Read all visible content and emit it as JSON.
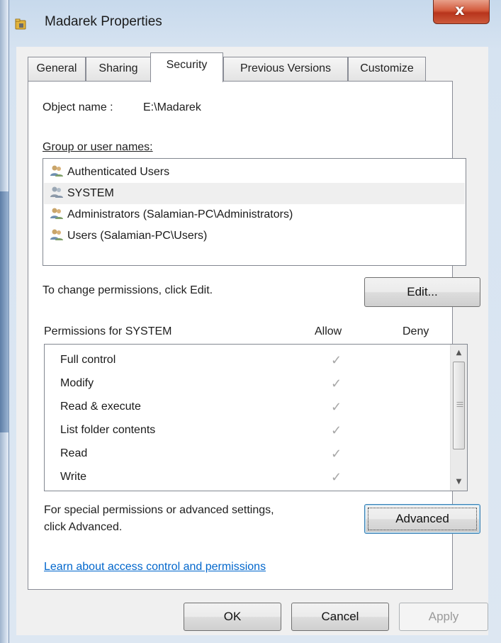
{
  "window": {
    "title": "Madarek Properties",
    "close_glyph": "x",
    "app_icon": "folder-lock-icon"
  },
  "tabs": [
    {
      "label": "General"
    },
    {
      "label": "Sharing"
    },
    {
      "label": "Security",
      "active": true
    },
    {
      "label": "Previous Versions"
    },
    {
      "label": "Customize"
    }
  ],
  "security": {
    "object_name_label": "Object name :",
    "object_name_value": "E:\\Madarek",
    "group_label": "Group or user names:",
    "users": [
      {
        "name": "Authenticated Users",
        "icon": "users-icon"
      },
      {
        "name": "SYSTEM",
        "icon": "users-icon",
        "selected": true
      },
      {
        "name": "Administrators (Salamian-PC\\Administrators)",
        "icon": "users-icon"
      },
      {
        "name": "Users (Salamian-PC\\Users)",
        "icon": "users-icon"
      }
    ],
    "change_text": "To change permissions, click Edit.",
    "edit_button": "Edit...",
    "permissions_label": "Permissions for SYSTEM",
    "allow_header": "Allow",
    "deny_header": "Deny",
    "permissions": [
      {
        "name": "Full control",
        "allow": true,
        "deny": false
      },
      {
        "name": "Modify",
        "allow": true,
        "deny": false
      },
      {
        "name": "Read & execute",
        "allow": true,
        "deny": false
      },
      {
        "name": "List folder contents",
        "allow": true,
        "deny": false
      },
      {
        "name": "Read",
        "allow": true,
        "deny": false
      },
      {
        "name": "Write",
        "allow": true,
        "deny": false
      }
    ],
    "check_glyph": "✓",
    "advanced_text_line1": "For special permissions or advanced settings,",
    "advanced_text_line2": "click Advanced.",
    "advanced_button": "Advanced",
    "learn_link": "Learn about access control and permissions"
  },
  "footer": {
    "ok": "OK",
    "cancel": "Cancel",
    "apply": "Apply"
  },
  "colors": {
    "link": "#0066cc",
    "close_button": "#c9452a",
    "check_disabled": "#a8a8a8"
  }
}
